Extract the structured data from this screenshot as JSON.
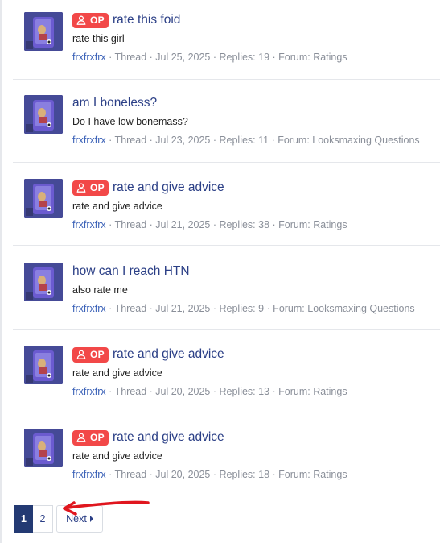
{
  "colors": {
    "title": "#2b3f86",
    "author": "#3d63b8",
    "meta": "#8a8f99",
    "op_badge": "#f24848",
    "pager_current": "#233a73",
    "annotation": "#e0161e"
  },
  "results": [
    {
      "op": true,
      "title": "rate this foid",
      "snippet": "rate this girl",
      "author": "frxfrxfrx",
      "meta": " · Thread · Jul 25, 2025 · Replies: 19 · Forum: Ratings"
    },
    {
      "op": false,
      "title": "am I boneless?",
      "snippet": "Do I have low bonemass?",
      "author": "frxfrxfrx",
      "meta": " · Thread · Jul 23, 2025 · Replies: 11 · Forum: Looksmaxing Questions"
    },
    {
      "op": true,
      "title": "rate and give advice",
      "snippet": "rate and give advice",
      "author": "frxfrxfrx",
      "meta": " · Thread · Jul 21, 2025 · Replies: 38 · Forum: Ratings"
    },
    {
      "op": false,
      "title": "how can I reach HTN",
      "snippet": "also rate me",
      "author": "frxfrxfrx",
      "meta": " · Thread · Jul 21, 2025 · Replies: 9 · Forum: Looksmaxing Questions"
    },
    {
      "op": true,
      "title": "rate and give advice",
      "snippet": "rate and give advice",
      "author": "frxfrxfrx",
      "meta": " · Thread · Jul 20, 2025 · Replies: 13 · Forum: Ratings"
    },
    {
      "op": true,
      "title": "rate and give advice",
      "snippet": "rate and give advice",
      "author": "frxfrxfrx",
      "meta": " · Thread · Jul 20, 2025 · Replies: 18 · Forum: Ratings"
    }
  ],
  "op_badge_label": "OP",
  "op_icon": "user-icon",
  "pagination": {
    "pages": [
      "1",
      "2"
    ],
    "current": "1",
    "next_label": "Next",
    "next_icon": "caret-right-icon"
  }
}
